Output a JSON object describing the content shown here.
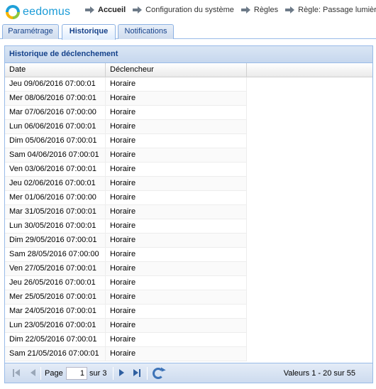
{
  "brand": {
    "logo_text": "eedomus"
  },
  "breadcrumb": [
    {
      "label": "Accueil",
      "bold": true
    },
    {
      "label": "Configuration du système",
      "bold": false
    },
    {
      "label": "Règles",
      "bold": false
    },
    {
      "label": "Règle: Passage lumière",
      "bold": false
    }
  ],
  "tabs": [
    {
      "label": "Paramétrage",
      "active": false
    },
    {
      "label": "Historique",
      "active": true
    },
    {
      "label": "Notifications",
      "active": false
    }
  ],
  "panel": {
    "title": "Historique de déclenchement"
  },
  "grid": {
    "columns": [
      "Date",
      "Déclencheur"
    ],
    "rows": [
      [
        "Jeu 09/06/2016 07:00:01",
        "Horaire"
      ],
      [
        "Mer 08/06/2016 07:00:01",
        "Horaire"
      ],
      [
        "Mar 07/06/2016 07:00:00",
        "Horaire"
      ],
      [
        "Lun 06/06/2016 07:00:01",
        "Horaire"
      ],
      [
        "Dim 05/06/2016 07:00:01",
        "Horaire"
      ],
      [
        "Sam 04/06/2016 07:00:01",
        "Horaire"
      ],
      [
        "Ven 03/06/2016 07:00:01",
        "Horaire"
      ],
      [
        "Jeu 02/06/2016 07:00:01",
        "Horaire"
      ],
      [
        "Mer 01/06/2016 07:00:00",
        "Horaire"
      ],
      [
        "Mar 31/05/2016 07:00:01",
        "Horaire"
      ],
      [
        "Lun 30/05/2016 07:00:01",
        "Horaire"
      ],
      [
        "Dim 29/05/2016 07:00:01",
        "Horaire"
      ],
      [
        "Sam 28/05/2016 07:00:00",
        "Horaire"
      ],
      [
        "Ven 27/05/2016 07:00:01",
        "Horaire"
      ],
      [
        "Jeu 26/05/2016 07:00:01",
        "Horaire"
      ],
      [
        "Mer 25/05/2016 07:00:01",
        "Horaire"
      ],
      [
        "Mar 24/05/2016 07:00:01",
        "Horaire"
      ],
      [
        "Lun 23/05/2016 07:00:01",
        "Horaire"
      ],
      [
        "Dim 22/05/2016 07:00:01",
        "Horaire"
      ],
      [
        "Sam 21/05/2016 07:00:01",
        "Horaire"
      ]
    ]
  },
  "pager": {
    "page_label": "Page",
    "current_page": "1",
    "total_label": "sur 3",
    "values_label": "Valeurs 1 - 20 sur 55",
    "icons": [
      "first-page-icon",
      "prev-page-icon",
      "next-page-icon",
      "last-page-icon",
      "refresh-icon"
    ]
  },
  "colors": {
    "brand_blue": "#1a9bd7",
    "panel_border": "#99bbe8",
    "title_text": "#15428b"
  }
}
